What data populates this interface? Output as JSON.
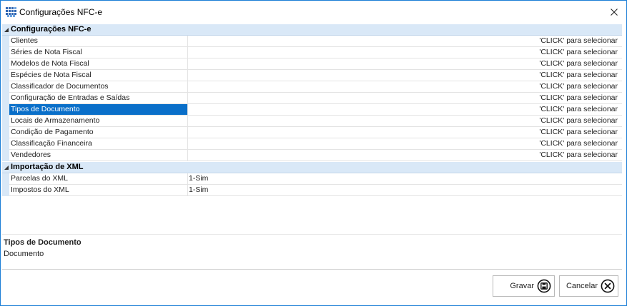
{
  "window": {
    "title": "Configurações NFC-e"
  },
  "grid": {
    "categories": [
      {
        "label": "Configurações NFC-e",
        "rows": [
          {
            "name": "Clientes",
            "value": "'CLICK' para selecionar"
          },
          {
            "name": "Séries de Nota Fiscal",
            "value": "'CLICK' para selecionar"
          },
          {
            "name": "Modelos de Nota Fiscal",
            "value": "'CLICK' para selecionar"
          },
          {
            "name": "Espécies de Nota Fiscal",
            "value": "'CLICK' para selecionar"
          },
          {
            "name": "Classificador de Documentos",
            "value": "'CLICK' para selecionar"
          },
          {
            "name": "Configuração de Entradas e Saídas",
            "value": "'CLICK' para selecionar"
          },
          {
            "name": "Tipos de Documento",
            "value": "'CLICK' para selecionar",
            "selected": true
          },
          {
            "name": "Locais de Armazenamento",
            "value": "'CLICK' para selecionar"
          },
          {
            "name": "Condição de Pagamento",
            "value": "'CLICK' para selecionar"
          },
          {
            "name": "Classificação Financeira",
            "value": "'CLICK' para selecionar"
          },
          {
            "name": "Vendedores",
            "value": "'CLICK' para selecionar"
          }
        ]
      },
      {
        "label": "Importação de XML",
        "rows": [
          {
            "name": "Parcelas do XML",
            "value": "1-Sim"
          },
          {
            "name": "Impostos do XML",
            "value": "1-Sim"
          }
        ]
      }
    ]
  },
  "description": {
    "title": "Tipos de Documento",
    "text": "Documento"
  },
  "buttons": {
    "save_label": "Gravar",
    "cancel_label": "Cancelar"
  },
  "colors": {
    "selection": "#0a6fc9",
    "category_bg": "#d9e8f7",
    "window_border": "#1b7ed6"
  },
  "icons": {
    "app": "grid-app-icon",
    "close": "close-icon",
    "save": "floppy-disk-icon",
    "cancel": "cancel-circle-icon"
  }
}
